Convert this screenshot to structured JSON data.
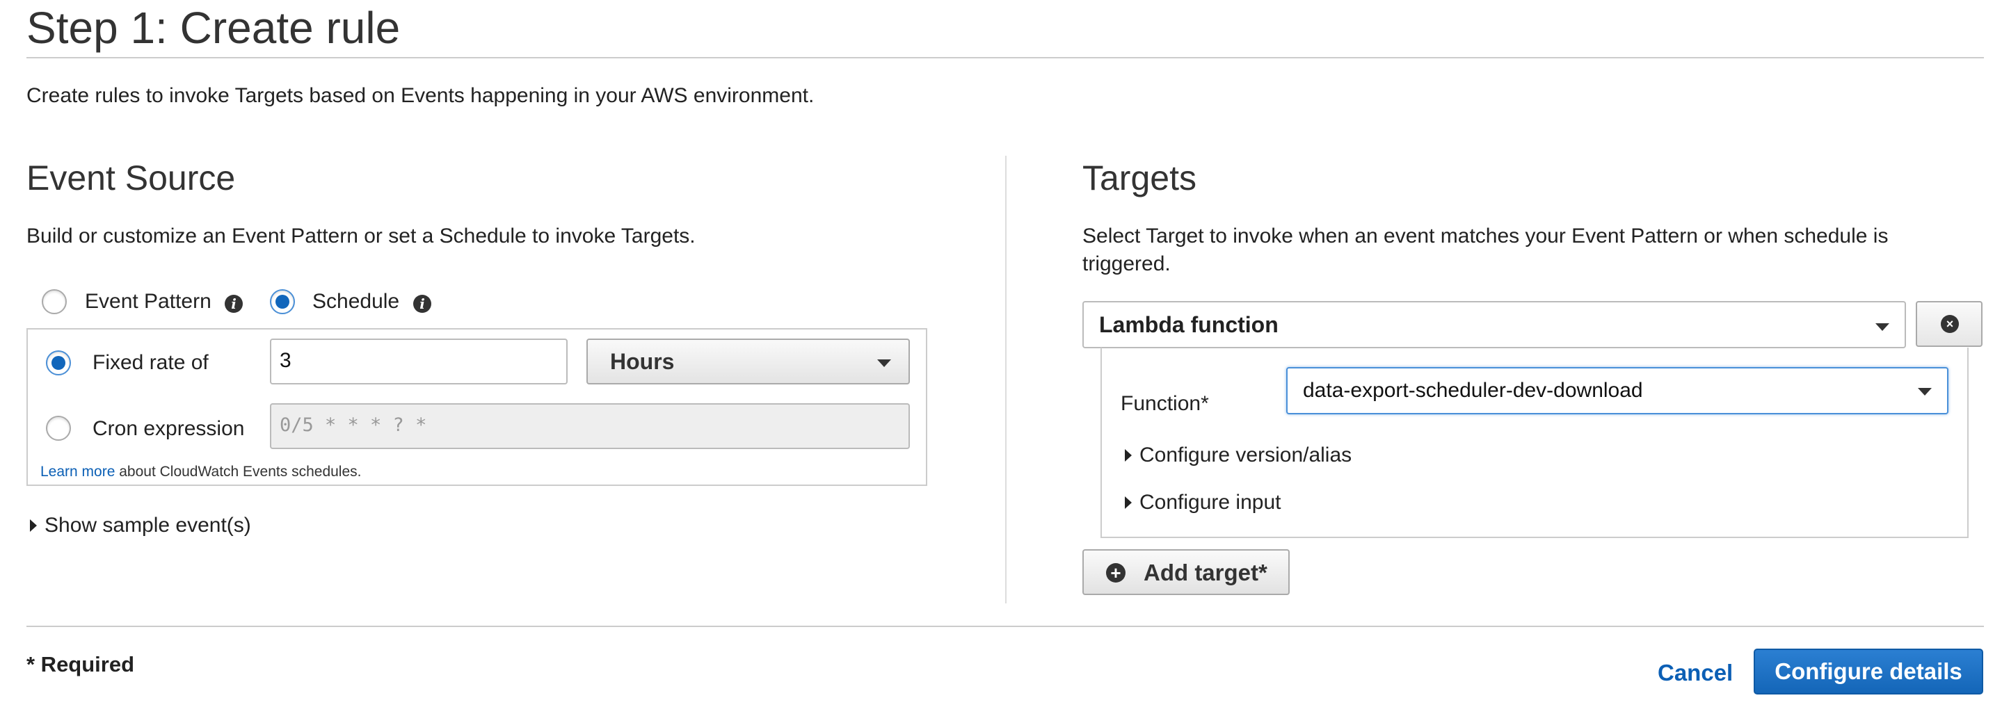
{
  "page": {
    "title": "Step 1: Create rule",
    "subtitle": "Create rules to invoke Targets based on Events happening in your AWS environment."
  },
  "event_source": {
    "title": "Event Source",
    "description": "Build or customize an Event Pattern or set a Schedule to invoke Targets.",
    "mode_options": [
      {
        "label": "Event Pattern",
        "selected": false
      },
      {
        "label": "Schedule",
        "selected": true
      }
    ],
    "info_glyph": "i",
    "fixed_rate_label": "Fixed rate of",
    "fixed_rate_selected": true,
    "fixed_rate_value": "3",
    "rate_unit": "Hours",
    "cron_label": "Cron expression",
    "cron_placeholder": "0/5 * * * ? *",
    "learn_more_link": "Learn more",
    "learn_more_suffix": " about CloudWatch Events schedules.",
    "show_sample": "Show sample event(s)"
  },
  "targets": {
    "title": "Targets",
    "description": "Select Target to invoke when an event matches your Event Pattern or when schedule is triggered.",
    "target_type": "Lambda function",
    "remove_glyph": "×",
    "function_label": "Function*",
    "function_value": "data-export-scheduler-dev-download",
    "configure_version": "Configure version/alias",
    "configure_input": "Configure input",
    "add_glyph": "+",
    "add_target": "Add target*"
  },
  "footer": {
    "required_note": "* Required",
    "cancel": "Cancel",
    "configure_details": "Configure details"
  },
  "colors": {
    "primary": "#1466b8",
    "link": "#0b5fb5",
    "focus": "#4a90d9"
  },
  "icons": [
    "info-icon",
    "remove-icon",
    "add-icon",
    "caret-down-icon",
    "expand-arrow-icon"
  ]
}
